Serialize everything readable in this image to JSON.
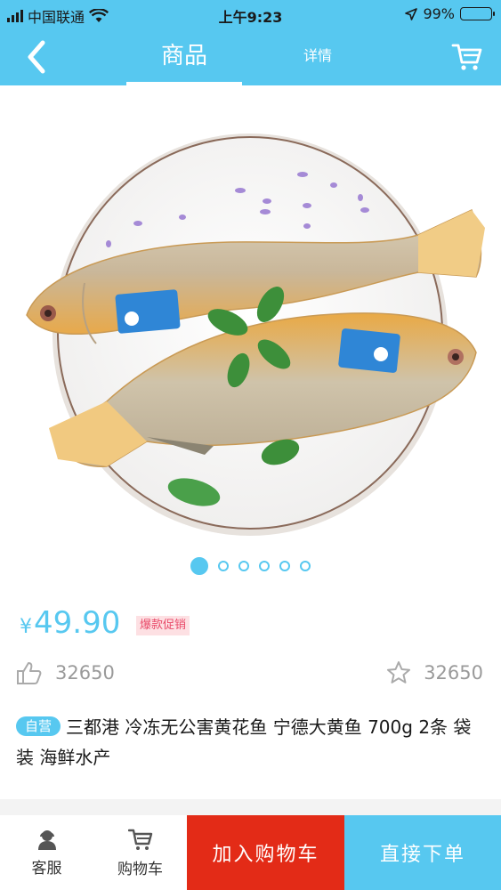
{
  "status_bar": {
    "carrier": "中国联通",
    "time": "上午9:23",
    "battery": "99%",
    "icons": [
      "signal-icon",
      "wifi-icon",
      "location-icon",
      "battery-icon"
    ]
  },
  "nav": {
    "tab_goods": "商品",
    "tab_detail": "详情",
    "icons": [
      "back-icon",
      "cart-icon"
    ]
  },
  "gallery": {
    "image_alt": "product photo: two yellow croakers on a white plate",
    "page_count": 6,
    "current_page": 1
  },
  "product": {
    "currency": "¥",
    "price": "49.90",
    "promo_tag": "爆款促销",
    "likes": "32650",
    "favorites": "32650",
    "self_tag": "自营",
    "title": "三都港 冷冻无公害黄花鱼 宁德大黄鱼 700g 2条 袋装 海鲜水产"
  },
  "bottom_bar": {
    "service_label": "客服",
    "cart_label": "购物车",
    "add_to_cart": "加入购物车",
    "buy_now": "直接下单"
  },
  "colors": {
    "accent": "#57c8f0",
    "add_cart_bg": "#e32b17",
    "promo_text": "#e94b6a"
  }
}
